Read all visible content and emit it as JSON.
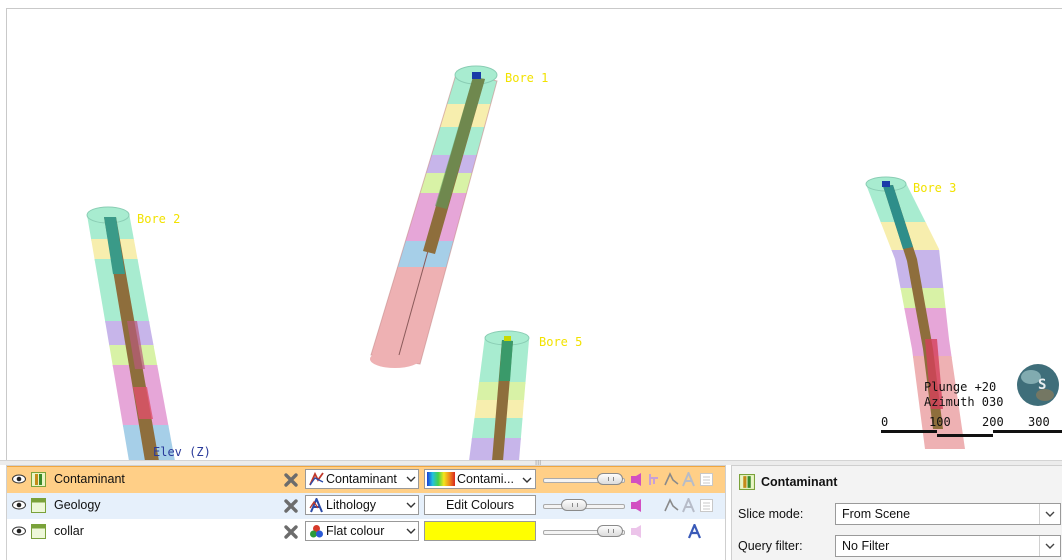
{
  "scene": {
    "bores": [
      {
        "label": "Bore 1"
      },
      {
        "label": "Bore 2"
      },
      {
        "label": "Bore 5"
      },
      {
        "label": "Bore 3"
      }
    ],
    "axis_label": "Elev (Z)",
    "orientation": {
      "plunge": "Plunge +20",
      "azimuth": "Azimuth 030"
    },
    "scale_bar": {
      "ticks": [
        "0",
        "100",
        "200",
        "300"
      ]
    },
    "compass_letter": "S",
    "colors": {
      "bore_label": "#f2e200",
      "axis_label": "#2a3a9a"
    }
  },
  "layers": [
    {
      "name": "Contaminant",
      "style": "Contaminant",
      "colour": "Contami...",
      "opacity": 0.9,
      "selected": true
    },
    {
      "name": "Geology",
      "style": "Lithology",
      "colour": "Edit Colours",
      "opacity": 0.3,
      "selected": false
    },
    {
      "name": "collar",
      "style": "Flat colour",
      "colour": "",
      "opacity": 0.9,
      "selected": false
    }
  ],
  "properties": {
    "title": "Contaminant",
    "slice_mode": {
      "label": "Slice mode:",
      "value": "From Scene"
    },
    "query_filter": {
      "label": "Query filter:",
      "value": "No Filter"
    }
  },
  "accent_colors": {
    "selection": "#ffcf87",
    "alt_row": "#e6f0fb",
    "flat_colour": "#ffff00"
  }
}
